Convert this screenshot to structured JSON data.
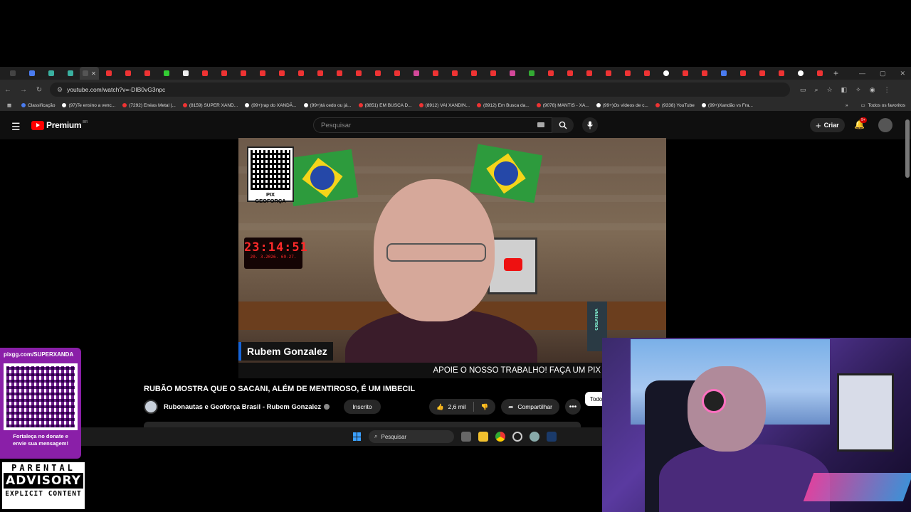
{
  "browser": {
    "url": "youtube.com/watch?v=-DIB0vG3npc",
    "bookmarks": [
      {
        "label": "Classificação",
        "icon": "globe"
      },
      {
        "label": "(97)Te ensino a venc...",
        "icon": "tiktok"
      },
      {
        "label": "(7292) Enéas Metal |...",
        "icon": "youtube"
      },
      {
        "label": "(8159) SUPER XAND...",
        "icon": "youtube"
      },
      {
        "label": "(99+)rap do XANDÃ...",
        "icon": "tiktok"
      },
      {
        "label": "(99+)tá cedo ou já...",
        "icon": "tiktok"
      },
      {
        "label": "(8851) EM BUSCA D...",
        "icon": "youtube"
      },
      {
        "label": "(8912) VAI XANDIN...",
        "icon": "youtube"
      },
      {
        "label": "(8912) Em Busca da...",
        "icon": "youtube"
      },
      {
        "label": "(9078) MANTIS - XA...",
        "icon": "youtube"
      },
      {
        "label": "(99+)Os vídeos de c...",
        "icon": "tiktok"
      },
      {
        "label": "(9338) YouTube",
        "icon": "youtube"
      },
      {
        "label": "(99+)Xandão vs Fra...",
        "icon": "tiktok"
      }
    ],
    "bookmarks_more": "»",
    "all_favorites": "Todos os favoritos"
  },
  "youtube": {
    "logo_text": "Premium",
    "region": "BR",
    "search_placeholder": "Pesquisar",
    "create_label": "Criar",
    "notif_badge": "9+"
  },
  "video": {
    "qr_label": "PIX GEOFORÇA",
    "clock_time": "23:14:51",
    "clock_date": "20. 3.2026.   69-27.",
    "can_text": "CREATINA",
    "lower_third_name": "Rubem Gonzalez",
    "ticker": "APOIE O NOSSO TRABALHO! FAÇA UM PIX --> pixgeoforca@"
  },
  "watch": {
    "title": "RUBÃO MOSTRA QUE O SACANI, ALÉM DE MENTIROSO, É UM IMBECIL",
    "channel": "Rubonautas e Geoforça Brasil - Rubem Gonzalez",
    "subscribe_label": "Inscrito",
    "likes": "2,6 mil",
    "share_label": "Compartilhar",
    "chip_label": "Todos"
  },
  "taskbar": {
    "search_placeholder": "Pesquisar"
  },
  "overlay": {
    "donate_url": "pixgg.com/SUPERXANDA",
    "donate_msg_1": "Fortaleça no donate e",
    "donate_msg_2": "envie sua mensagem!",
    "advisory_top": "PARENTAL",
    "advisory_mid": "ADVISORY",
    "advisory_bottom": "EXPLICIT CONTENT"
  },
  "colors": {
    "yt_red": "#ff0000",
    "donate_purple": "#8a1fa8",
    "clock_red": "#ff2a2a",
    "accent_blue": "#1664d8"
  }
}
